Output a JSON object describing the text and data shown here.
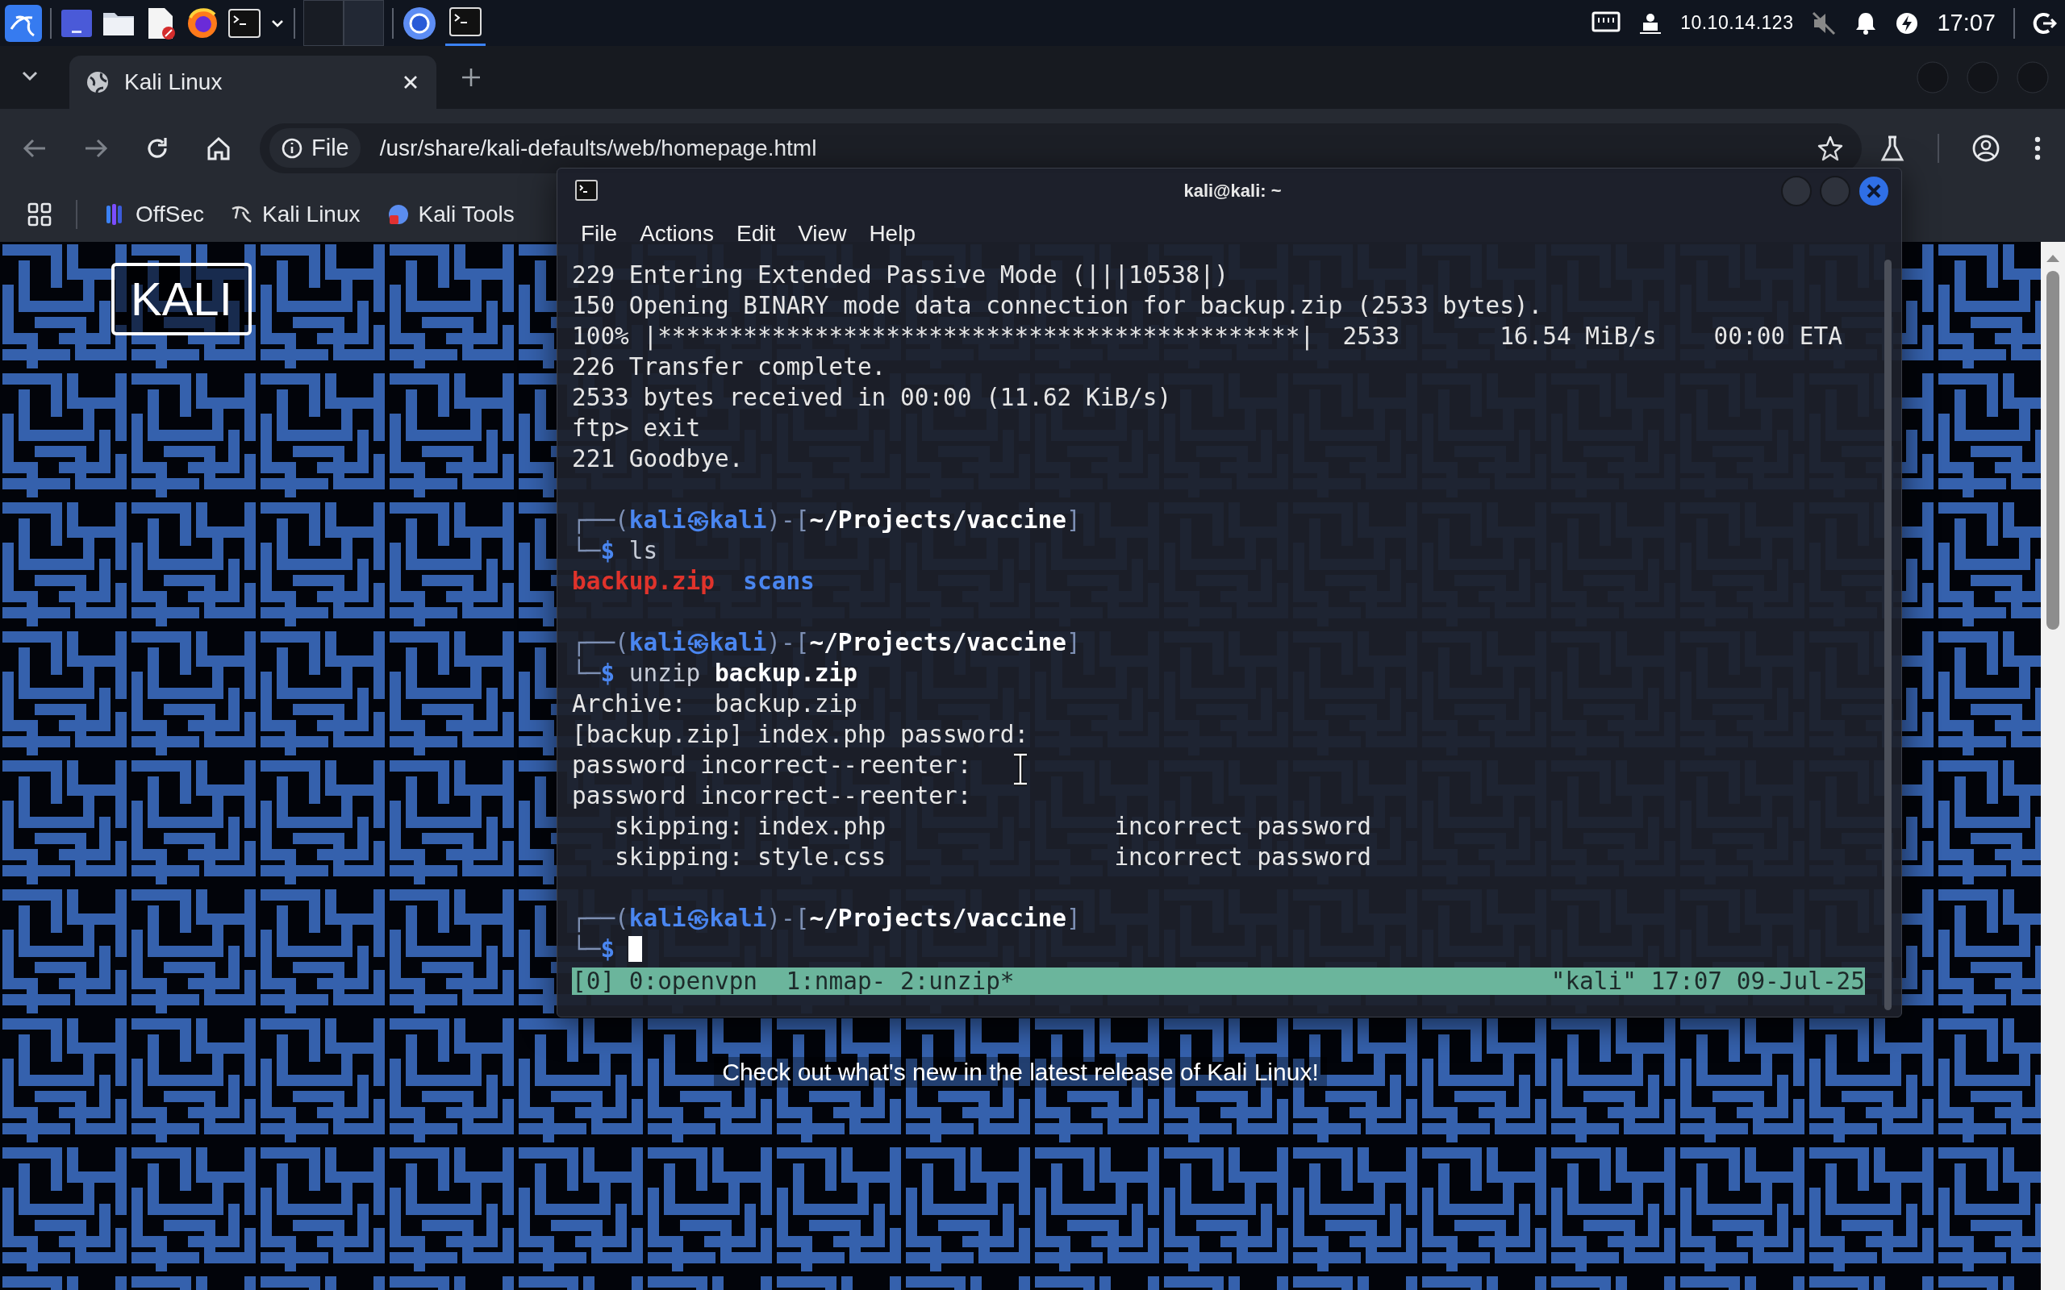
{
  "top_panel": {
    "ip_address": "10.10.14.123",
    "clock": "17:07"
  },
  "browser": {
    "tabs": [
      {
        "title": "Kali Linux",
        "selected": true
      }
    ],
    "address": {
      "scheme": "File",
      "url": "/usr/share/kali-defaults/web/homepage.html"
    },
    "bookmarks": [
      {
        "label": "OffSec"
      },
      {
        "label": "Kali Linux"
      },
      {
        "label": "Kali Tools"
      }
    ]
  },
  "page": {
    "logo": "KALI",
    "tagline": "Check out what's new in the latest release of Kali Linux!"
  },
  "terminal": {
    "title": "kali@kali: ~",
    "menu": [
      "File",
      "Actions",
      "Edit",
      "View",
      "Help"
    ],
    "lines": [
      {
        "kind": "output",
        "segments": [
          {
            "kind": "plain",
            "text": "229 Entering Extended Passive Mode (|||10538|)"
          }
        ]
      },
      {
        "kind": "output",
        "segments": [
          {
            "kind": "plain",
            "text": "150 Opening BINARY mode data connection for backup.zip (2533 bytes)."
          }
        ]
      },
      {
        "kind": "output",
        "segments": [
          {
            "kind": "plain",
            "text": "100% |*********************************************|  2533       16.54 MiB/s    00:00 ETA"
          }
        ]
      },
      {
        "kind": "output",
        "segments": [
          {
            "kind": "plain",
            "text": "226 Transfer complete."
          }
        ]
      },
      {
        "kind": "output",
        "segments": [
          {
            "kind": "plain",
            "text": "2533 bytes received in 00:00 (11.62 KiB/s)"
          }
        ]
      },
      {
        "kind": "output",
        "segments": [
          {
            "kind": "plain",
            "text": "ftp> exit"
          }
        ]
      },
      {
        "kind": "output",
        "segments": [
          {
            "kind": "plain",
            "text": "221 Goodbye."
          }
        ]
      },
      {
        "kind": "blank"
      },
      {
        "kind": "prompt",
        "segments": [
          {
            "kind": "frame",
            "text": "┌──("
          },
          {
            "kind": "user",
            "text": "kali㉿kali"
          },
          {
            "kind": "frame",
            "text": ")-["
          },
          {
            "kind": "path",
            "text": "~/Projects/vaccine"
          },
          {
            "kind": "frame",
            "text": "]"
          }
        ]
      },
      {
        "kind": "prompt",
        "segments": [
          {
            "kind": "frame",
            "text": "└─"
          },
          {
            "kind": "sign",
            "text": "$"
          },
          {
            "kind": "cmd",
            "text": " ls"
          }
        ]
      },
      {
        "kind": "output",
        "segments": [
          {
            "kind": "archive",
            "text": "backup.zip"
          },
          {
            "kind": "dir",
            "text": "  scans"
          }
        ]
      },
      {
        "kind": "blank"
      },
      {
        "kind": "prompt",
        "segments": [
          {
            "kind": "frame",
            "text": "┌──("
          },
          {
            "kind": "user",
            "text": "kali㉿kali"
          },
          {
            "kind": "frame",
            "text": ")-["
          },
          {
            "kind": "path",
            "text": "~/Projects/vaccine"
          },
          {
            "kind": "frame",
            "text": "]"
          }
        ]
      },
      {
        "kind": "prompt",
        "segments": [
          {
            "kind": "frame",
            "text": "└─"
          },
          {
            "kind": "sign",
            "text": "$"
          },
          {
            "kind": "cmd",
            "text": " unzip "
          },
          {
            "kind": "arg",
            "text": "backup.zip"
          }
        ]
      },
      {
        "kind": "output",
        "segments": [
          {
            "kind": "plain",
            "text": "Archive:  backup.zip"
          }
        ]
      },
      {
        "kind": "output",
        "segments": [
          {
            "kind": "plain",
            "text": "[backup.zip] index.php password:"
          }
        ]
      },
      {
        "kind": "output",
        "segments": [
          {
            "kind": "plain",
            "text": "password incorrect--reenter:"
          }
        ]
      },
      {
        "kind": "output",
        "segments": [
          {
            "kind": "plain",
            "text": "password incorrect--reenter:"
          }
        ]
      },
      {
        "kind": "output",
        "segments": [
          {
            "kind": "plain",
            "text": "   skipping: index.php                incorrect password"
          }
        ]
      },
      {
        "kind": "output",
        "segments": [
          {
            "kind": "plain",
            "text": "   skipping: style.css                incorrect password"
          }
        ]
      },
      {
        "kind": "blank"
      },
      {
        "kind": "prompt",
        "segments": [
          {
            "kind": "frame",
            "text": "┌──("
          },
          {
            "kind": "user",
            "text": "kali㉿kali"
          },
          {
            "kind": "frame",
            "text": ")-["
          },
          {
            "kind": "path",
            "text": "~/Projects/vaccine"
          },
          {
            "kind": "frame",
            "text": "]"
          }
        ]
      },
      {
        "kind": "prompt",
        "segments": [
          {
            "kind": "frame",
            "text": "└─"
          },
          {
            "kind": "sign",
            "text": "$"
          },
          {
            "kind": "cursor"
          }
        ]
      }
    ],
    "status_left": "[0] 0:openvpn  1:nmap- 2:unzip*",
    "status_right": "\"kali\" 17:07 09-Jul-25"
  }
}
